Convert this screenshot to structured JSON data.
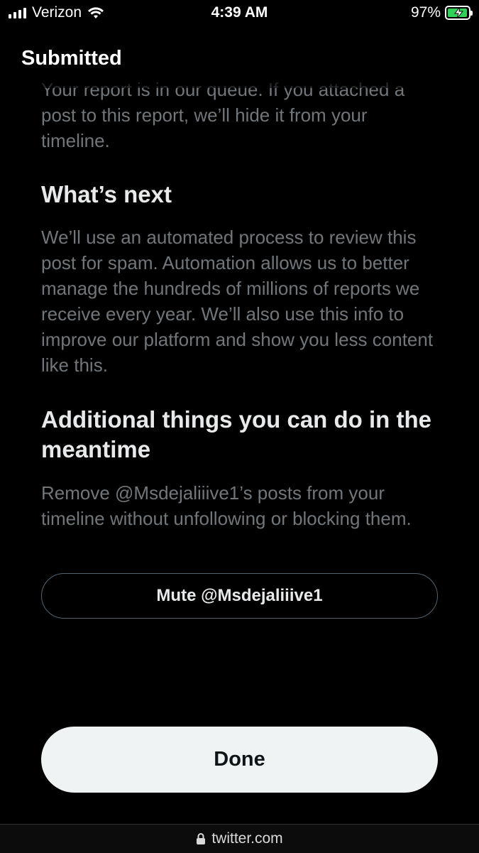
{
  "status_bar": {
    "carrier": "Verizon",
    "time": "4:39 AM",
    "battery_percent": "97%",
    "battery_level": 0.97,
    "battery_color": "#30d158",
    "icons": [
      "signal-icon",
      "wifi-icon",
      "battery-icon",
      "charging-bolt-icon"
    ]
  },
  "header": {
    "title": "Submitted"
  },
  "intro": {
    "text": "Your report is in our queue. If you attached a post to this report, we’ll hide it from your timeline."
  },
  "whats_next": {
    "title": "What’s next",
    "body": "We’ll use an automated process to review this post for spam. Automation allows us to better manage the hundreds of millions of reports we receive every year. We’ll also use this info to improve our platform and show you less content like this."
  },
  "additional": {
    "title": "Additional things you can do in the meantime",
    "body": "Remove @Msdejaliiive1’s posts from your timeline without unfollowing or blocking them.",
    "mute_label": "Mute @Msdejaliiive1"
  },
  "footer": {
    "done_label": "Done"
  },
  "url_bar": {
    "url": "twitter.com",
    "icon": "lock-icon"
  },
  "colors": {
    "background": "#000000",
    "heading": "#e7e9ea",
    "body_text": "#71767b",
    "button_border": "#536471",
    "done_bg": "#eff3f4",
    "done_text": "#0f1419"
  }
}
